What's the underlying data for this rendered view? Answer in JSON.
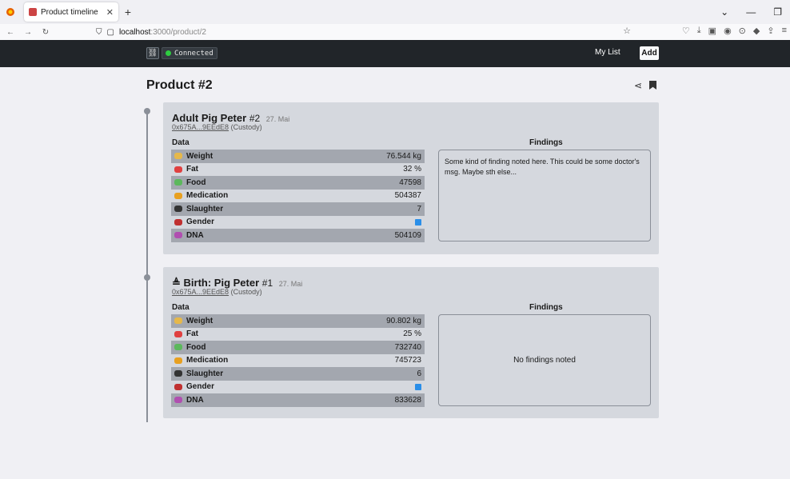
{
  "browser": {
    "tab_title": "Product timeline",
    "url_host": "localhost",
    "url_path": ":3000/product/2"
  },
  "header": {
    "status": "Connected",
    "my_list": "My List",
    "add": "Add"
  },
  "page": {
    "title": "Product #2"
  },
  "entries": [
    {
      "title": "Adult Pig Peter",
      "num": "#2",
      "date": "27. Mai",
      "address": "0x675A...9EEdE8",
      "role": "(Custody)",
      "data_label": "Data",
      "findings_label": "Findings",
      "rows": [
        {
          "label": "Weight",
          "value": "76.544 kg",
          "icon_color": "#e6b84a"
        },
        {
          "label": "Fat",
          "value": "32 %",
          "icon_color": "#e04040"
        },
        {
          "label": "Food",
          "value": "47598",
          "icon_color": "#5cb85c"
        },
        {
          "label": "Medication",
          "value": "504387",
          "icon_color": "#e8a020"
        },
        {
          "label": "Slaughter",
          "value": "7",
          "icon_color": "#333333"
        },
        {
          "label": "Gender",
          "value": "",
          "icon_color": "#c03030"
        },
        {
          "label": "DNA",
          "value": "504109",
          "icon_color": "#b04fb0"
        }
      ],
      "findings": "Some kind of finding noted here. This could be some doctor's msg. Maybe sth else..."
    },
    {
      "title": "Birth: Pig Peter",
      "num": "#1",
      "date": "27. Mai",
      "address": "0x675A...9EEdE8",
      "role": "(Custody)",
      "data_label": "Data",
      "findings_label": "Findings",
      "rows": [
        {
          "label": "Weight",
          "value": "90.802 kg",
          "icon_color": "#e6b84a"
        },
        {
          "label": "Fat",
          "value": "25 %",
          "icon_color": "#e04040"
        },
        {
          "label": "Food",
          "value": "732740",
          "icon_color": "#5cb85c"
        },
        {
          "label": "Medication",
          "value": "745723",
          "icon_color": "#e8a020"
        },
        {
          "label": "Slaughter",
          "value": "6",
          "icon_color": "#333333"
        },
        {
          "label": "Gender",
          "value": "",
          "icon_color": "#c03030"
        },
        {
          "label": "DNA",
          "value": "833628",
          "icon_color": "#b04fb0"
        }
      ],
      "findings": "No findings noted"
    }
  ]
}
